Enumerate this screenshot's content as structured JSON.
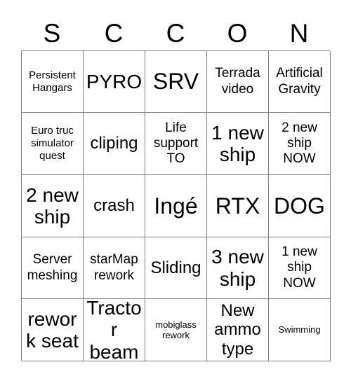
{
  "card": {
    "title_letters": [
      "S",
      "C",
      "C",
      "O",
      "N"
    ],
    "grid_size": "5x5",
    "colors": {
      "background": "#ffffff",
      "text": "#000000",
      "grid_line": "#808080"
    },
    "rows": [
      [
        {
          "text": "Persistent Hangars",
          "size": "fs-s"
        },
        {
          "text": "PYRO",
          "size": "fs-xl"
        },
        {
          "text": "SRV",
          "size": "fs-xxl"
        },
        {
          "text": "Terrada video",
          "size": "fs-m"
        },
        {
          "text": "Artificial Gravity",
          "size": "fs-m"
        }
      ],
      [
        {
          "text": "Euro truc simulator quest",
          "size": "fs-s"
        },
        {
          "text": "cliping",
          "size": "fs-l"
        },
        {
          "text": "Life support TO",
          "size": "fs-m"
        },
        {
          "text": "1 new ship",
          "size": "fs-xl"
        },
        {
          "text": "2 new ship NOW",
          "size": "fs-m"
        }
      ],
      [
        {
          "text": "2 new ship",
          "size": "fs-xl"
        },
        {
          "text": "crash",
          "size": "fs-l"
        },
        {
          "text": "Ingé",
          "size": "fs-xxl"
        },
        {
          "text": "RTX",
          "size": "fs-xxl"
        },
        {
          "text": "DOG",
          "size": "fs-xxl"
        }
      ],
      [
        {
          "text": "Server meshing",
          "size": "fs-m"
        },
        {
          "text": "starMap rework",
          "size": "fs-m"
        },
        {
          "text": "Sliding",
          "size": "fs-l"
        },
        {
          "text": "3 new ship",
          "size": "fs-xl"
        },
        {
          "text": "1 new ship NOW",
          "size": "fs-m"
        }
      ],
      [
        {
          "text": "rework seat",
          "size": "fs-xl"
        },
        {
          "text": "Tractor beam",
          "size": "fs-xl"
        },
        {
          "text": "mobiglass rework",
          "size": "fs-xs"
        },
        {
          "text": "New ammo type",
          "size": "fs-l"
        },
        {
          "text": "Swimming",
          "size": "fs-xs"
        }
      ]
    ]
  }
}
